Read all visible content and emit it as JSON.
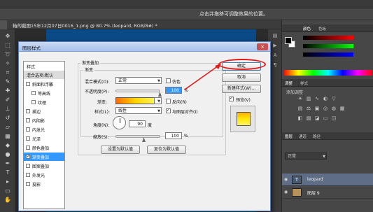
{
  "app": {
    "options_hint": "点击并拖移可调整效果的位置。",
    "document_tab": "箱的截图15年12月07日0016_1.png @ 80.7% (leopard, RGB/8#) *"
  },
  "right_panel": {
    "color_tabs": [
      "颜色",
      "色板"
    ],
    "adjust_tabs": [
      "调整",
      "样式"
    ],
    "adjust_caption": "添加调整",
    "layers_tabs": [
      "图层",
      "通道",
      "路径"
    ],
    "blend_mode": "正常",
    "layers": [
      {
        "name": "leopard",
        "selected": true
      },
      {
        "name": "图层 9",
        "selected": false
      }
    ],
    "accent_color": "#5f6e86"
  },
  "dialog": {
    "title": "图层样式",
    "close_glyph": "×",
    "styles_header": "样式",
    "blend_default": "混合选项:默认",
    "style_items": [
      {
        "label": "斜面和浮雕",
        "checked": false,
        "indent": false,
        "selected": false
      },
      {
        "label": "等高线",
        "checked": false,
        "indent": true,
        "selected": false
      },
      {
        "label": "纹理",
        "checked": false,
        "indent": true,
        "selected": false
      },
      {
        "label": "描边",
        "checked": false,
        "indent": false,
        "selected": false
      },
      {
        "label": "内阴影",
        "checked": false,
        "indent": false,
        "selected": false
      },
      {
        "label": "内发光",
        "checked": false,
        "indent": false,
        "selected": false
      },
      {
        "label": "光泽",
        "checked": false,
        "indent": false,
        "selected": false
      },
      {
        "label": "颜色叠加",
        "checked": false,
        "indent": false,
        "selected": false
      },
      {
        "label": "渐变叠加",
        "checked": true,
        "indent": false,
        "selected": true
      },
      {
        "label": "图案叠加",
        "checked": false,
        "indent": false,
        "selected": false
      },
      {
        "label": "外发光",
        "checked": false,
        "indent": false,
        "selected": false
      },
      {
        "label": "投影",
        "checked": false,
        "indent": false,
        "selected": false
      }
    ],
    "section_title": "渐变叠加",
    "subsection_title": "渐变",
    "blend_mode_label": "混合模式(O):",
    "blend_mode_value": "正常",
    "dither_label": "仿色",
    "opacity_label": "不透明度(P):",
    "opacity_value": "100",
    "percent": "%",
    "gradient_label": "渐变:",
    "reverse_label": "反向(R)",
    "style_label": "样式(L):",
    "style_value": "线性",
    "align_label": "与图层对齐(I)",
    "align_checked": true,
    "angle_label": "角度(N):",
    "angle_value": "90",
    "degree": "度",
    "scale_label": "缩放(S):",
    "scale_value": "100",
    "set_default_button": "设置为默认值",
    "reset_default_button": "复位为默认值",
    "ok_button": "确定",
    "cancel_button": "取消",
    "new_style_button": "新建样式(W)...",
    "preview_label": "预览(V)",
    "preview_checked": true
  },
  "annotation_color": "#e31b1b"
}
